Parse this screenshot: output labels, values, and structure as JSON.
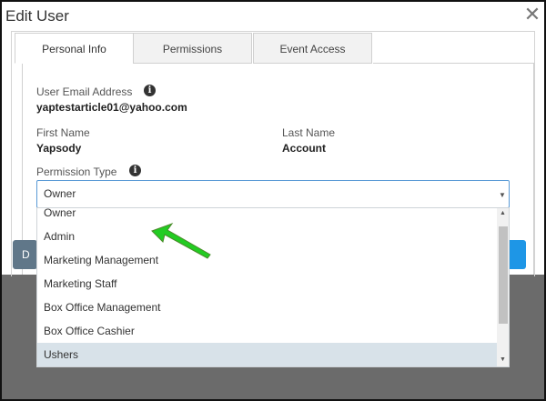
{
  "dialog": {
    "title": "Edit User",
    "close_glyph": "✕"
  },
  "tabs": [
    {
      "label": "Personal Info",
      "active": true
    },
    {
      "label": "Permissions",
      "active": false
    },
    {
      "label": "Event Access",
      "active": false
    }
  ],
  "form": {
    "email_label": "User Email Address",
    "email_value": "yaptestarticle01@yahoo.com",
    "first_name_label": "First Name",
    "first_name_value": "Yapsody",
    "last_name_label": "Last Name",
    "last_name_value": "Account",
    "permission_label": "Permission Type",
    "permission_value": "Owner",
    "info_glyph": "i"
  },
  "dropdown": {
    "options": [
      "Owner",
      "Admin",
      "Marketing Management",
      "Marketing Staff",
      "Box Office Management",
      "Box Office Cashier",
      "Ushers"
    ],
    "highlighted": "Ushers"
  },
  "footer": {
    "left_button_label": "D"
  },
  "annotation": {
    "icon": "green-arrow-icon",
    "color": "#22cc22"
  },
  "colors": {
    "select_border": "#5a9ad6",
    "left_button": "#607789",
    "right_button": "#1e96e6",
    "highlight": "#d8e2e9"
  }
}
